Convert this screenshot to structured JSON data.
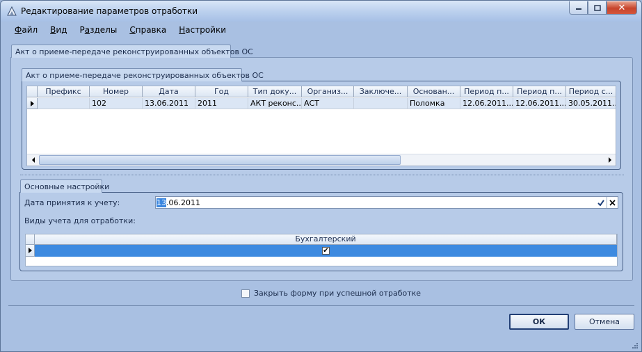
{
  "window": {
    "title": "Редактирование параметров отработки"
  },
  "menu": [
    {
      "prefix": "",
      "accel": "Ф",
      "rest": "айл"
    },
    {
      "prefix": "",
      "accel": "В",
      "rest": "ид"
    },
    {
      "prefix": "Р",
      "accel": "а",
      "rest": "зделы"
    },
    {
      "prefix": "",
      "accel": "С",
      "rest": "правка"
    },
    {
      "prefix": "",
      "accel": "Н",
      "rest": "астройки"
    }
  ],
  "outer_tab": {
    "label": "Акт о приеме-передаче реконструированных объектов ОС"
  },
  "inner_tab": {
    "label": "Акт о приеме-передаче реконструированных объектов ОС"
  },
  "grid": {
    "columns": [
      "Префикс",
      "Номер",
      "Дата",
      "Год",
      "Тип доку...",
      "Организ...",
      "Заключе...",
      "Основан...",
      "Период п...",
      "Период п...",
      "Период с..."
    ],
    "rows": [
      [
        "",
        "102",
        "13.06.2011",
        "2011",
        "АКТ реконс...",
        "АСТ",
        "",
        "Поломка",
        "12.06.2011...",
        "12.06.2011...",
        "30.05.2011..."
      ]
    ]
  },
  "settings": {
    "tab_label": "Основные настройки",
    "date_label": "Дата принятия к учету:",
    "date_value_selected": "13",
    "date_value_rest": ".06.2011",
    "types_label": "Виды учета для отработки:",
    "types_column": "Бухгалтерский",
    "types_checked": "✔"
  },
  "footer": {
    "close_on_success_label": "Закрыть форму при успешной отработке",
    "ok_label": "ОК",
    "cancel_label": "Отмена"
  }
}
